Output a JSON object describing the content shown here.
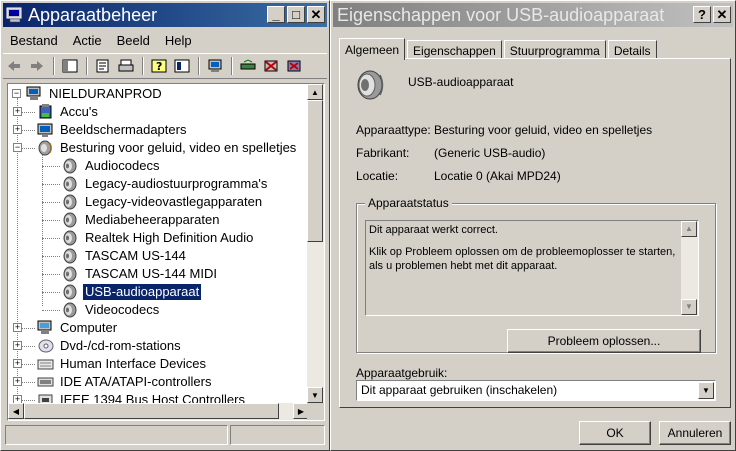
{
  "device_manager": {
    "title": "Apparaatbeheer",
    "title_buttons": [
      "_",
      "□",
      "✕"
    ],
    "menu": [
      "Bestand",
      "Actie",
      "Beeld",
      "Help"
    ],
    "toolbar_icons": [
      "back-arrow-icon",
      "forward-arrow-icon",
      "console-tree-icon",
      "properties-icon",
      "print-icon",
      "help-icon",
      "view-icon",
      "computer-scan-icon",
      "update-driver-icon",
      "disable-device-icon",
      "uninstall-device-icon"
    ],
    "tree": {
      "root": "NIELDURANPROD",
      "items": [
        {
          "label": "Accu's",
          "icon": "battery-icon",
          "level": 1,
          "expander": "+"
        },
        {
          "label": "Beeldschermadapters",
          "icon": "display-adapter-icon",
          "level": 1,
          "expander": "+"
        },
        {
          "label": "Besturing voor geluid, video en spelletjes",
          "icon": "sound-icon",
          "level": 1,
          "expander": "-"
        },
        {
          "label": "Audiocodecs",
          "icon": "speaker-icon",
          "level": 2
        },
        {
          "label": "Legacy-audiostuurprogramma's",
          "icon": "speaker-icon",
          "level": 2
        },
        {
          "label": "Legacy-videovastlegapparaten",
          "icon": "speaker-icon",
          "level": 2
        },
        {
          "label": "Mediabeheerapparaten",
          "icon": "speaker-icon",
          "level": 2
        },
        {
          "label": "Realtek High Definition Audio",
          "icon": "speaker-icon",
          "level": 2
        },
        {
          "label": "TASCAM US-144",
          "icon": "speaker-icon",
          "level": 2
        },
        {
          "label": "TASCAM US-144 MIDI",
          "icon": "speaker-icon",
          "level": 2
        },
        {
          "label": "USB-audioapparaat",
          "icon": "speaker-icon",
          "level": 2,
          "selected": true
        },
        {
          "label": "Videocodecs",
          "icon": "speaker-icon",
          "level": 2
        },
        {
          "label": "Computer",
          "icon": "computer-icon",
          "level": 1,
          "expander": "+"
        },
        {
          "label": "Dvd-/cd-rom-stations",
          "icon": "cdrom-icon",
          "level": 1,
          "expander": "+"
        },
        {
          "label": "Human Interface Devices",
          "icon": "hid-icon",
          "level": 1,
          "expander": "+"
        },
        {
          "label": "IDE ATA/ATAPI-controllers",
          "icon": "ide-controller-icon",
          "level": 1,
          "expander": "+"
        },
        {
          "label": "IEEE 1394 Bus Host Controllers",
          "icon": "firewire-icon",
          "level": 1,
          "expander": "+"
        }
      ]
    }
  },
  "properties_dialog": {
    "title": "Eigenschappen voor USB-audioapparaat",
    "title_buttons": [
      "?",
      "✕"
    ],
    "tabs": [
      "Algemeen",
      "Eigenschappen",
      "Stuurprogramma",
      "Details"
    ],
    "active_tab": "Algemeen",
    "device_name": "USB-audioapparaat",
    "fields": [
      {
        "label": "Apparaattype:",
        "value": "Besturing voor geluid, video en spelletjes"
      },
      {
        "label": "Fabrikant:",
        "value": "(Generic USB-audio)"
      },
      {
        "label": "Locatie:",
        "value": "Locatie 0 (Akai MPD24)"
      }
    ],
    "status_group": {
      "title": "Apparaatstatus",
      "line1": "Dit apparaat werkt correct.",
      "line2": "Klik op Probleem oplossen om de probleemoplosser te starten, als u problemen hebt met dit apparaat."
    },
    "troubleshoot_button": "Probleem oplossen...",
    "usage": {
      "label": "Apparaatgebruik:",
      "selected": "Dit apparaat gebruiken (inschakelen)"
    },
    "ok_button": "OK",
    "cancel_button": "Annuleren"
  }
}
